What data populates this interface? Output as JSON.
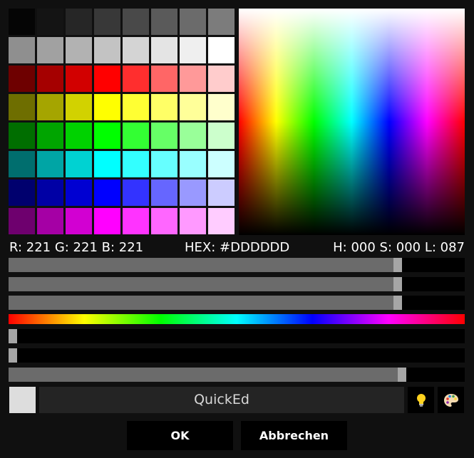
{
  "palette": {
    "rows": [
      [
        "#050505",
        "#141414",
        "#262626",
        "#383838",
        "#494949",
        "#5a5a5a",
        "#6b6b6b",
        "#7c7c7c"
      ],
      [
        "#8f8f8f",
        "#a1a1a1",
        "#b2b2b2",
        "#c3c3c3",
        "#d4d4d4",
        "#e4e4e4",
        "#efefef",
        "#ffffff"
      ],
      [
        "#6e0000",
        "#a50000",
        "#d20000",
        "#ff0000",
        "#ff2e2e",
        "#ff6666",
        "#ff9999",
        "#ffcccc"
      ],
      [
        "#6e6e00",
        "#a5a500",
        "#d2d200",
        "#ffff00",
        "#ffff33",
        "#ffff66",
        "#ffff99",
        "#ffffcc"
      ],
      [
        "#006e00",
        "#00a500",
        "#00d200",
        "#00ff00",
        "#33ff33",
        "#66ff66",
        "#99ff99",
        "#ccffcc"
      ],
      [
        "#006e6e",
        "#00a5a5",
        "#00d2d2",
        "#00ffff",
        "#33ffff",
        "#66ffff",
        "#99ffff",
        "#ccffff"
      ],
      [
        "#00006e",
        "#0000a5",
        "#0000d2",
        "#0000ff",
        "#3333ff",
        "#6666ff",
        "#9999ff",
        "#ccccff"
      ],
      [
        "#6e006e",
        "#a500a5",
        "#d200d2",
        "#ff00ff",
        "#ff33ff",
        "#ff66ff",
        "#ff99ff",
        "#ffccff"
      ]
    ]
  },
  "readout": {
    "rgb": "R: 221 G: 221 B: 221",
    "hex": "HEX: #DDDDDD",
    "hsl": "H: 000 S: 000 L: 087"
  },
  "sliders": {
    "red": 0.86,
    "green": 0.86,
    "blue": 0.86,
    "hue": 0.0,
    "saturation": 0.0,
    "lightness": 0.87
  },
  "current_color": "#dddddd",
  "name_field": {
    "value": "QuickEd"
  },
  "icons": {
    "suggest": "lightbulb-icon",
    "palette": "palette-icon"
  },
  "buttons": {
    "ok": "OK",
    "cancel": "Abbrechen"
  }
}
